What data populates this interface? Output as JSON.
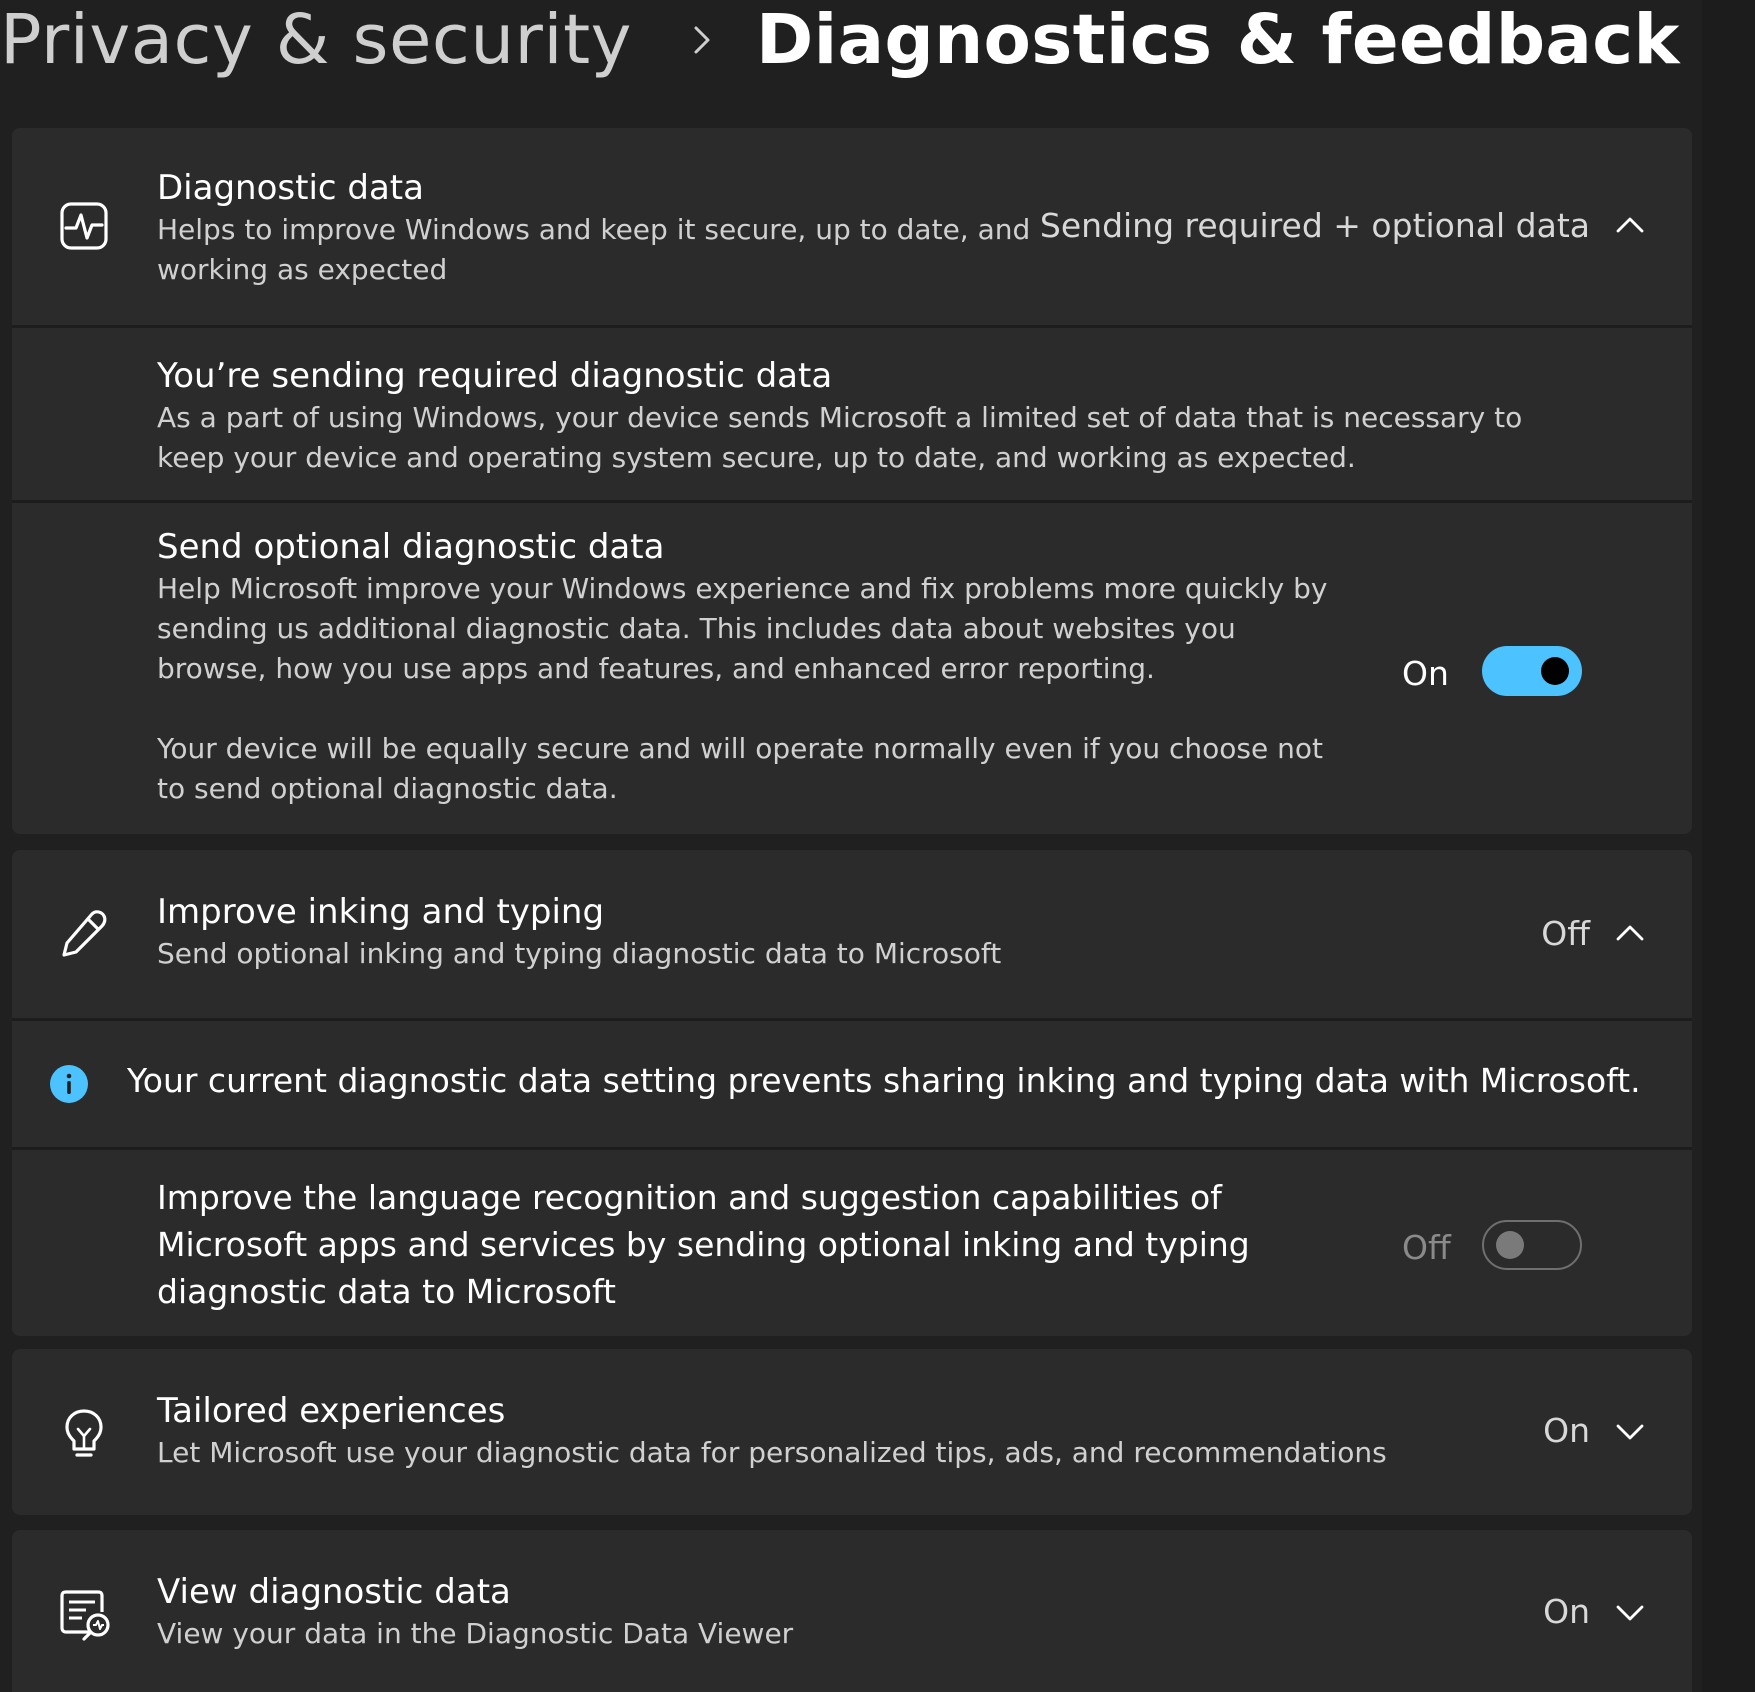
{
  "breadcrumb": {
    "parent": "Privacy & security",
    "current": "Diagnostics & feedback"
  },
  "diagnostic_data": {
    "title": "Diagnostic data",
    "description": "Helps to improve Windows and keep it secure, up to date, and working as expected",
    "status": "Sending required + optional data",
    "expanded": true,
    "icon": "diagnostic-pulse-icon",
    "required": {
      "title": "You’re sending required diagnostic data",
      "description": "As a part of using Windows, your device sends Microsoft a limited set of data that is necessary to keep your device and operating system secure, up to date, and working as expected."
    },
    "optional": {
      "title": "Send optional diagnostic data",
      "description": "Help Microsoft improve your Windows experience and fix problems more quickly by sending us additional diagnostic data. This includes data about websites you browse, how you use apps and features, and enhanced error reporting.",
      "note": "Your device will be equally secure and will operate normally even if you choose not to send optional diagnostic data.",
      "toggle_label": "On",
      "toggle_state": true
    }
  },
  "inking": {
    "title": "Improve inking and typing",
    "description": "Send optional inking and typing diagnostic data to Microsoft",
    "status": "Off",
    "expanded": true,
    "icon": "pen-icon",
    "info_message": "Your current diagnostic data setting prevents sharing inking and typing data with Microsoft.",
    "setting_description": "Improve the language recognition and suggestion capabilities of Microsoft apps and services by sending optional inking and typing diagnostic data to Microsoft",
    "toggle_label": "Off",
    "toggle_state": false
  },
  "tailored": {
    "title": "Tailored experiences",
    "description": "Let Microsoft use your diagnostic data for personalized tips, ads, and recommendations",
    "status": "On",
    "expanded": false,
    "icon": "lightbulb-icon"
  },
  "view_data": {
    "title": "View diagnostic data",
    "description": "View your data in the Diagnostic Data Viewer",
    "status": "On",
    "expanded": false,
    "icon": "diagnostic-viewer-icon"
  },
  "colors": {
    "background": "#202020",
    "card": "#2b2b2b",
    "accent": "#4cc2ff",
    "text_primary": "#ffffff",
    "text_secondary": "#d0d0d0"
  }
}
